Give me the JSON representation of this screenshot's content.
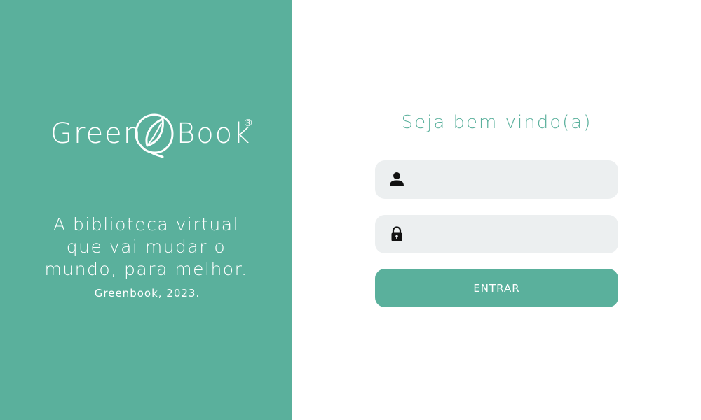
{
  "brand": {
    "name_left": "Green",
    "name_right": "Book",
    "registered_mark": "®",
    "logo_icon": "leaf-circle-icon"
  },
  "tagline": {
    "lines": [
      "A biblioteca virtual",
      "que vai mudar o",
      "mundo, para melhor."
    ],
    "signature": "Greenbook, 2023."
  },
  "login": {
    "welcome": "Seja bem vindo(a)",
    "username": {
      "value": "",
      "placeholder": "",
      "icon": "user-icon"
    },
    "password": {
      "value": "",
      "placeholder": "",
      "icon": "lock-icon"
    },
    "submit_label": "ENTRAR"
  },
  "colors": {
    "brand_green": "#5ab09c",
    "field_background": "#eceff0",
    "background": "#ffffff"
  }
}
